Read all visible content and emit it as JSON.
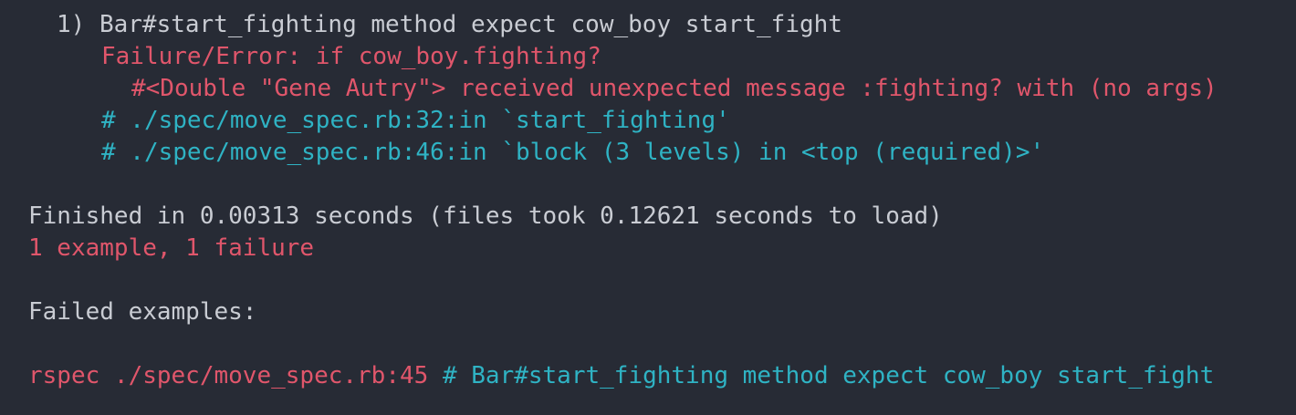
{
  "colors": {
    "background": "#272b35",
    "text": "#c9ccd3",
    "error": "#e0566b",
    "trace": "#2fb3c4"
  },
  "failure": {
    "title": "1) Bar#start_fighting method expect cow_boy start_fight",
    "error_label": "Failure/Error: if cow_boy.fighting?",
    "error_message": "#<Double \"Gene Autry\"> received unexpected message :fighting? with (no args)",
    "backtrace": [
      "# ./spec/move_spec.rb:32:in `start_fighting'",
      "# ./spec/move_spec.rb:46:in `block (3 levels) in <top (required)>'"
    ]
  },
  "summary": {
    "finished": "Finished in 0.00313 seconds (files took 0.12621 seconds to load)",
    "result": "1 example, 1 failure"
  },
  "failed_examples": {
    "heading": "Failed examples:",
    "command": "rspec ./spec/move_spec.rb:45",
    "comment": "# Bar#start_fighting method expect cow_boy start_fight"
  }
}
